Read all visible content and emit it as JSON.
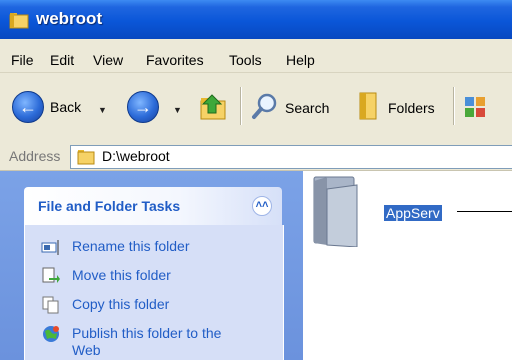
{
  "window": {
    "title": "webroot"
  },
  "menubar": {
    "items": [
      "File",
      "Edit",
      "View",
      "Favorites",
      "Tools",
      "Help"
    ]
  },
  "toolbar": {
    "back_label": "Back",
    "search_label": "Search",
    "folders_label": "Folders"
  },
  "address": {
    "label": "Address",
    "value": "D:\\webroot"
  },
  "taskpane": {
    "header": "File and Folder Tasks",
    "tasks": [
      "Rename this folder",
      "Move this folder",
      "Copy this folder",
      "Publish this folder to the Web"
    ]
  },
  "files": [
    {
      "name": "AppServ",
      "selected": true
    }
  ],
  "colors": {
    "titlebar": "#0a56d8",
    "selection": "#316ac5",
    "task_link": "#215dc6"
  },
  "icons": [
    "folder-icon",
    "back-icon",
    "forward-icon",
    "up-folder-icon",
    "search-icon",
    "folders-icon",
    "views-icon",
    "rename-icon",
    "move-icon",
    "copy-icon",
    "publish-icon"
  ]
}
